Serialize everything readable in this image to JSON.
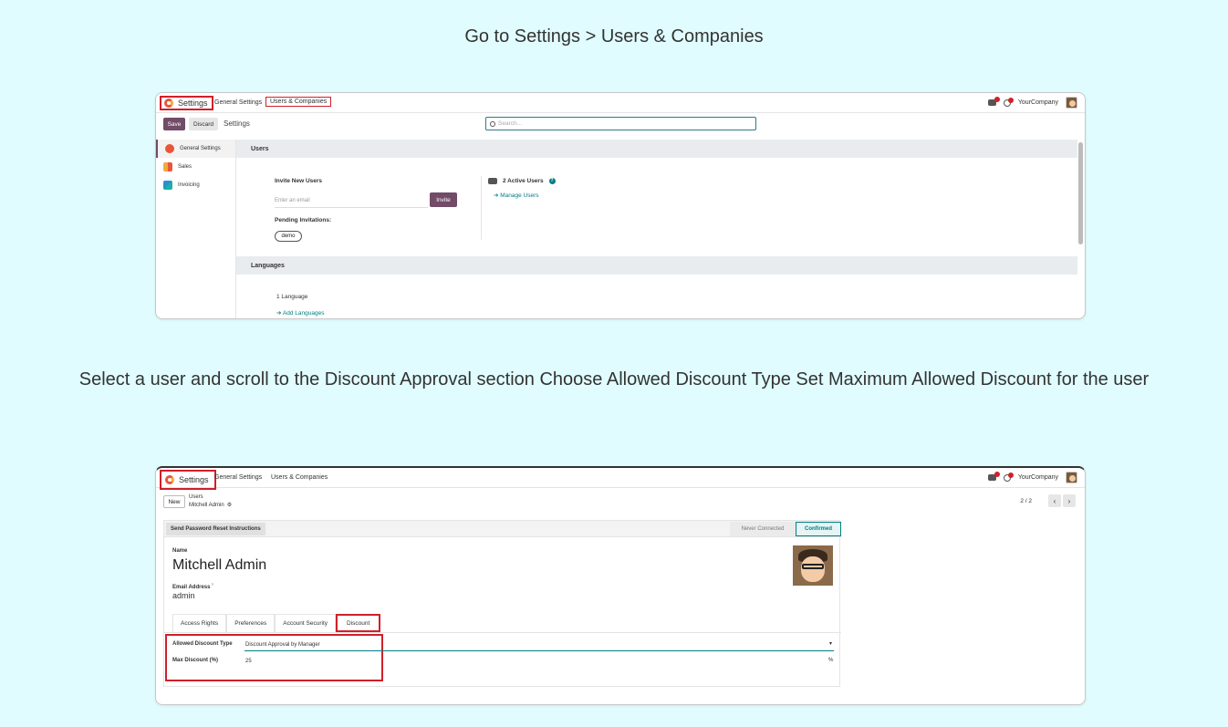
{
  "captions": {
    "step1": "Go to Settings > Users & Companies",
    "step2": "Select a user and scroll to the Discount Approval section Choose Allowed Discount Type Set Maximum Allowed Discount for the user"
  },
  "common": {
    "app_name": "Settings",
    "nav_general": "General Settings",
    "nav_users": "Users & Companies",
    "company": "YourCompany"
  },
  "shot1": {
    "save": "Save",
    "discard": "Discard",
    "title": "Settings",
    "search_placeholder": "Search...",
    "sidebar": [
      {
        "label": "General Settings"
      },
      {
        "label": "Sales"
      },
      {
        "label": "Invoicing"
      }
    ],
    "users_section": "Users",
    "invite_label": "Invite New Users",
    "email_placeholder": "Enter an email",
    "invite_button": "Invite",
    "pending_label": "Pending Invitations:",
    "pending_tag": "demo",
    "active_users": "2 Active Users",
    "manage_users": "Manage Users",
    "languages_section": "Languages",
    "language_count": "1 Language",
    "add_languages": "Add Languages"
  },
  "shot2": {
    "new": "New",
    "breadcrumb_parent": "Users",
    "breadcrumb_current": "Mitchell Admin",
    "pager": "2 / 2",
    "reset_button": "Send Password Reset Instructions",
    "stage_never": "Never Connected",
    "stage_confirmed": "Confirmed",
    "name_label": "Name",
    "name_value": "Mitchell Admin",
    "email_label": "Email Address",
    "email_value": "admin",
    "tabs": [
      "Access Rights",
      "Preferences",
      "Account Security",
      "Discount"
    ],
    "allowed_discount_label": "Allowed Discount Type",
    "allowed_discount_value": "Discount Approval by Manager",
    "max_discount_label": "Max Discount (%)",
    "max_discount_value": "25",
    "percent": "%"
  },
  "colors": {
    "brand": "#714b67",
    "accent": "#017e84",
    "highlight": "#d0202a",
    "background": "#e0fcfe"
  }
}
